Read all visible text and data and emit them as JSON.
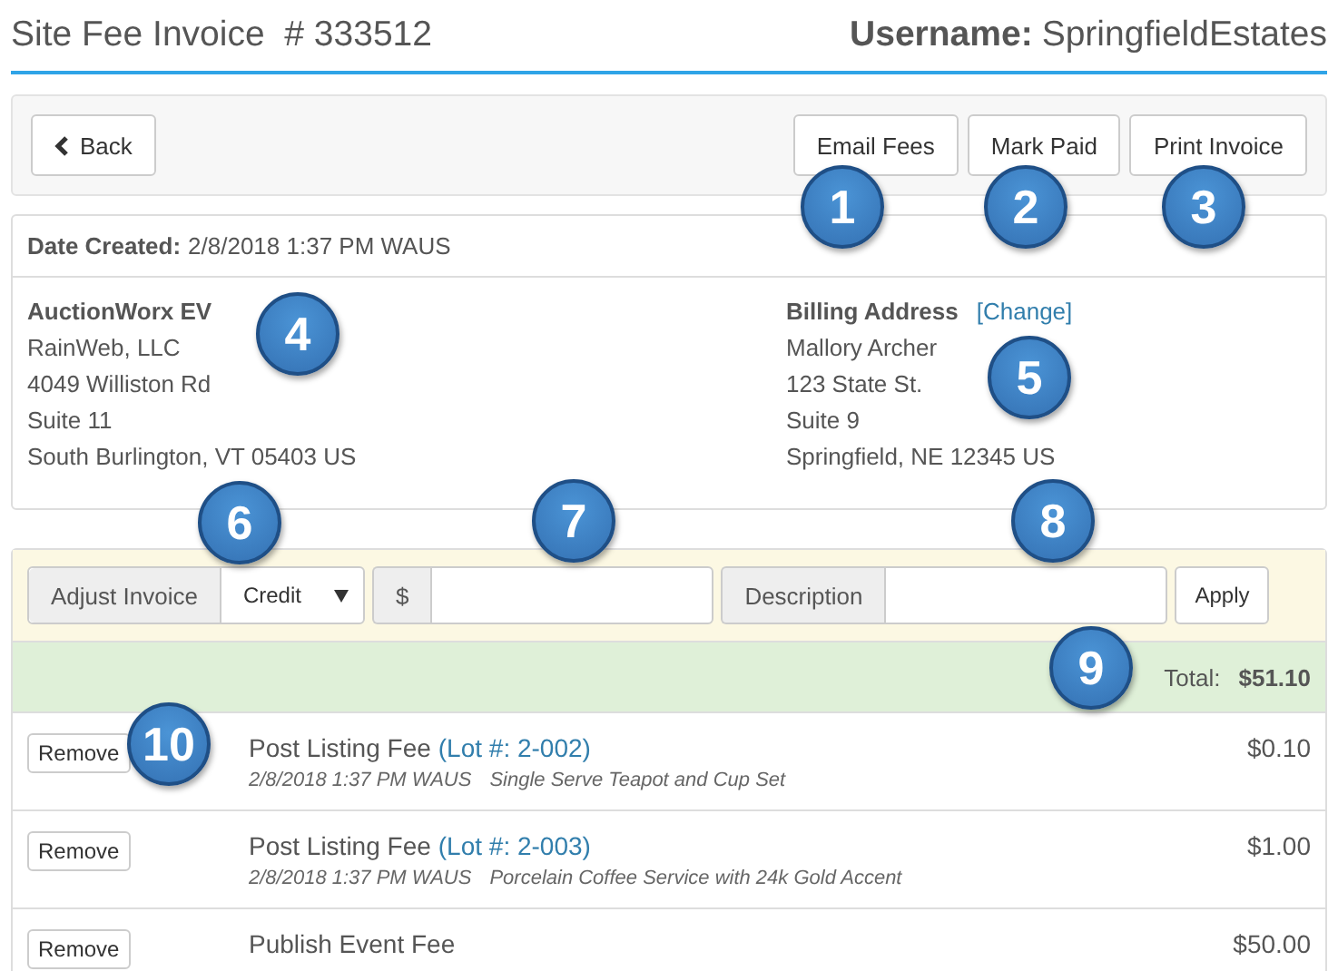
{
  "header": {
    "title": "Site Fee Invoice  # 333512",
    "username_label": "Username:",
    "username": "SpringfieldEstates"
  },
  "toolbar": {
    "back": "Back",
    "actions": [
      "Email Fees",
      "Mark Paid",
      "Print Invoice"
    ]
  },
  "invoice": {
    "date_label": "Date Created:",
    "date": "2/8/2018 1:37 PM WAUS",
    "seller": {
      "name": "AuctionWorx EV",
      "lines": [
        "RainWeb, LLC",
        "4049 Williston Rd",
        "Suite 11",
        "South Burlington, VT 05403 US"
      ]
    },
    "billing": {
      "label": "Billing Address",
      "change_link": "[Change]",
      "lines": [
        "Mallory Archer",
        "123 State St.",
        "Suite 9",
        "Springfield, NE 12345 US"
      ]
    }
  },
  "adjust": {
    "label": "Adjust Invoice",
    "type": "Credit",
    "amount_addon": "$",
    "description_addon": "Description",
    "apply": "Apply"
  },
  "total": {
    "label": "Total:",
    "value": "$51.10"
  },
  "line_items": [
    {
      "remove": "Remove",
      "title": "Post Listing Fee",
      "lot": "(Lot #: 2-002)",
      "date": "2/8/2018 1:37 PM WAUS",
      "description": "Single Serve Teapot and Cup Set",
      "amount": "$0.10"
    },
    {
      "remove": "Remove",
      "title": "Post Listing Fee",
      "lot": "(Lot #: 2-003)",
      "date": "2/8/2018 1:37 PM WAUS",
      "description": "Porcelain Coffee Service with 24k Gold Accent",
      "amount": "$1.00"
    },
    {
      "remove": "Remove",
      "title": "Publish Event Fee",
      "amount": "$50.00"
    }
  ],
  "callouts": [
    "1",
    "2",
    "3",
    "4",
    "5",
    "6",
    "7",
    "8",
    "9",
    "10"
  ]
}
